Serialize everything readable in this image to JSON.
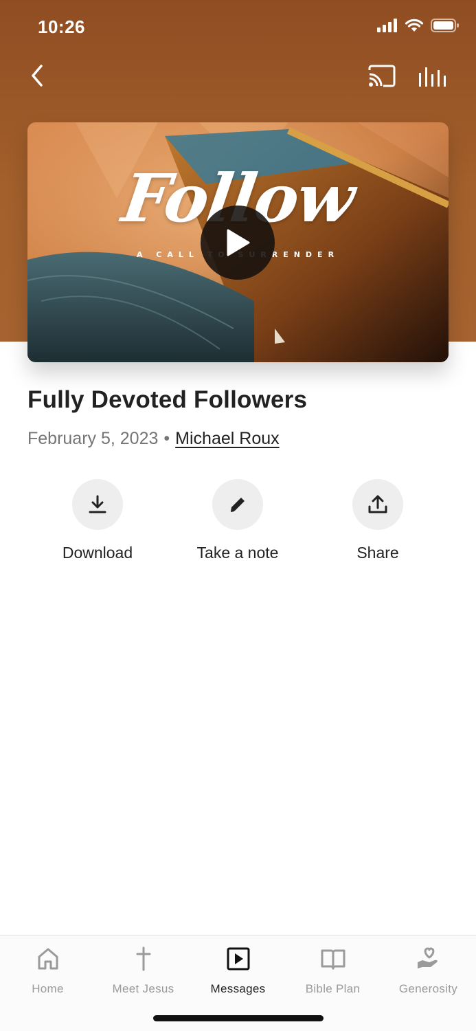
{
  "status_bar": {
    "time": "10:26"
  },
  "artwork": {
    "title": "Follow",
    "subtitle": "A CALL TO SURRENDER"
  },
  "message": {
    "title": "Fully Devoted Followers",
    "date": "February 5, 2023",
    "separator": "•",
    "speaker": "Michael Roux"
  },
  "actions": [
    {
      "label": "Download",
      "icon": "download-icon"
    },
    {
      "label": "Take a note",
      "icon": "pencil-icon"
    },
    {
      "label": "Share",
      "icon": "share-icon"
    }
  ],
  "tabs": [
    {
      "label": "Home",
      "icon": "home-icon",
      "active": false
    },
    {
      "label": "Meet Jesus",
      "icon": "cross-icon",
      "active": false
    },
    {
      "label": "Messages",
      "icon": "play-square-icon",
      "active": true
    },
    {
      "label": "Bible Plan",
      "icon": "book-icon",
      "active": false
    },
    {
      "label": "Generosity",
      "icon": "heart-hand-icon",
      "active": false
    }
  ],
  "colors": {
    "header_brown": "#a3602c",
    "text_primary": "#222222",
    "text_secondary": "#757575",
    "tab_inactive": "#9a9a9a"
  }
}
